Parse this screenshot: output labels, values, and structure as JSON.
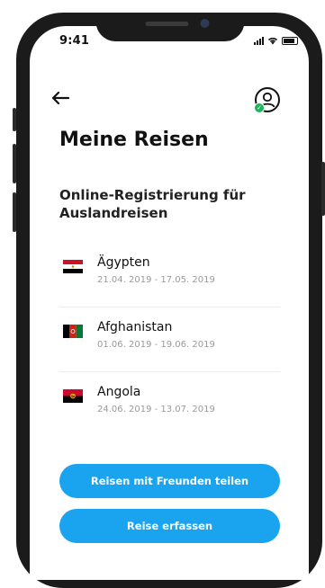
{
  "status_bar": {
    "time": "9:41"
  },
  "header": {
    "title": "Meine Reisen"
  },
  "section": {
    "title": "Online-Registrierung für Auslandreisen"
  },
  "trips": [
    {
      "country": "Ägypten",
      "dates": "21.04. 2019 - 17.05. 2019",
      "flag": "egypt-flag-icon"
    },
    {
      "country": "Afghanistan",
      "dates": "01.06. 2019 - 19.06. 2019",
      "flag": "afghanistan-flag-icon"
    },
    {
      "country": "Angola",
      "dates": "24.06. 2019 - 13.07. 2019",
      "flag": "angola-flag-icon"
    }
  ],
  "buttons": {
    "share": "Reisen mit Freunden teilen",
    "add": "Reise erfassen"
  },
  "colors": {
    "accent": "#1aa3ef",
    "status_ok": "#1bb55c"
  }
}
